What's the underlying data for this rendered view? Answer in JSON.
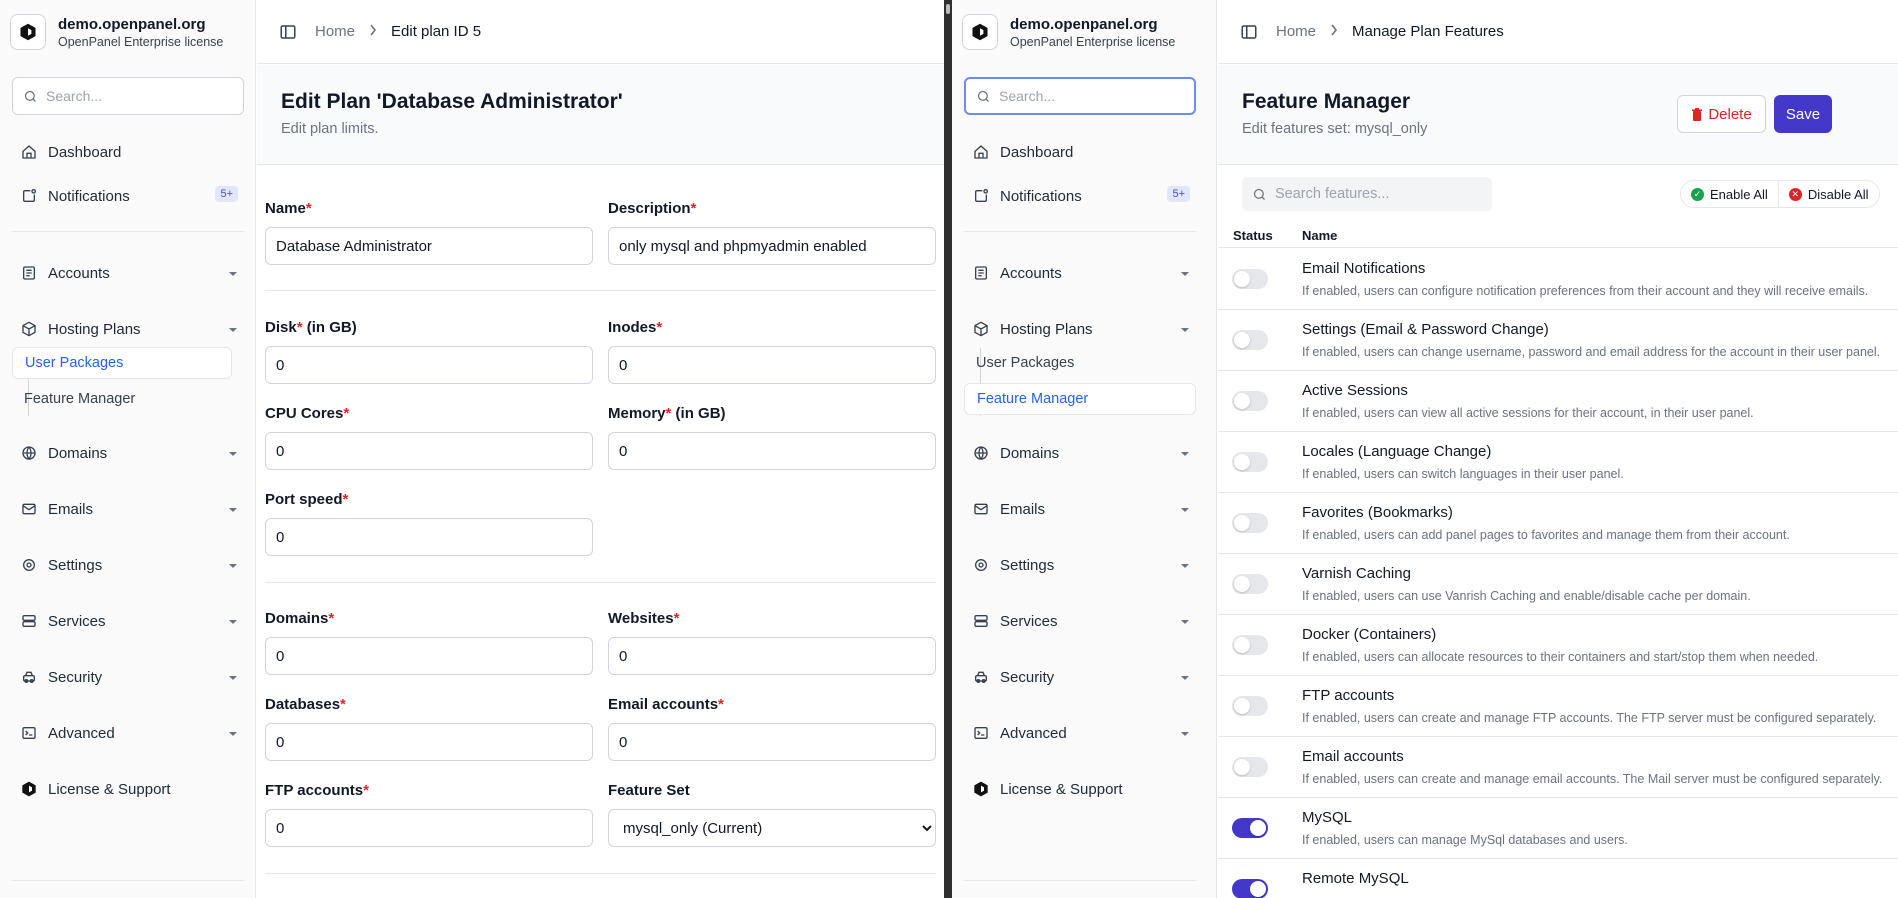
{
  "sidebar": {
    "brand_title": "demo.openpanel.org",
    "brand_subtitle": "OpenPanel Enterprise license",
    "search_placeholder": "Search...",
    "items": {
      "dashboard": "Dashboard",
      "notifications": "Notifications",
      "notifications_badge": "5+",
      "accounts": "Accounts",
      "hosting_plans": "Hosting Plans",
      "user_packages": "User Packages",
      "feature_manager": "Feature Manager",
      "domains": "Domains",
      "emails": "Emails",
      "settings": "Settings",
      "services": "Services",
      "security": "Security",
      "advanced": "Advanced",
      "license": "License & Support"
    }
  },
  "left": {
    "breadcrumb": {
      "home": "Home",
      "current": "Edit plan ID 5"
    },
    "title": "Edit Plan 'Database Administrator'",
    "subtitle": "Edit plan limits.",
    "required_mark": "*",
    "fields": {
      "name": {
        "label": "Name",
        "value": "Database Administrator"
      },
      "description": {
        "label": "Description",
        "value": "only mysql and phpmyadmin enabled"
      },
      "disk": {
        "label": "Disk",
        "suffix": " (in GB)",
        "value": "0"
      },
      "inodes": {
        "label": "Inodes",
        "value": "0"
      },
      "cpu": {
        "label": "CPU Cores",
        "value": "0"
      },
      "memory": {
        "label": "Memory",
        "suffix": " (in GB)",
        "value": "0"
      },
      "port_speed": {
        "label": "Port speed",
        "value": "0"
      },
      "domains": {
        "label": "Domains",
        "value": "0"
      },
      "websites": {
        "label": "Websites",
        "value": "0"
      },
      "databases": {
        "label": "Databases",
        "value": "0"
      },
      "email_accounts": {
        "label": "Email accounts",
        "value": "0"
      },
      "ftp_accounts": {
        "label": "FTP accounts",
        "value": "0"
      },
      "feature_set": {
        "label": "Feature Set",
        "value": "mysql_only (Current)"
      }
    }
  },
  "right": {
    "breadcrumb": {
      "home": "Home",
      "current": "Manage Plan Features"
    },
    "title": "Feature Manager",
    "subtitle": "Edit features set: mysql_only",
    "delete_label": "Delete",
    "save_label": "Save",
    "search_placeholder": "Search features...",
    "enable_all": "Enable All",
    "disable_all": "Disable All",
    "col_status": "Status",
    "col_name": "Name",
    "features": [
      {
        "name": "Email Notifications",
        "desc": "If enabled, users can configure notification preferences from their account and they will receive emails.",
        "enabled": false
      },
      {
        "name": "Settings (Email & Password Change)",
        "desc": "If enabled, users can change username, password and email address for the account in their user panel.",
        "enabled": false
      },
      {
        "name": "Active Sessions",
        "desc": "If enabled, users can view all active sessions for their account, in their user panel.",
        "enabled": false
      },
      {
        "name": "Locales (Language Change)",
        "desc": "If enabled, users can switch languages in their user panel.",
        "enabled": false
      },
      {
        "name": "Favorites (Bookmarks)",
        "desc": "If enabled, users can add panel pages to favorites and manage them from their account.",
        "enabled": false
      },
      {
        "name": "Varnish Caching",
        "desc": "If enabled, users can use Vanrish Caching and enable/disable cache per domain.",
        "enabled": false
      },
      {
        "name": "Docker (Containers)",
        "desc": "If enabled, users can allocate resources to their containers and start/stop them when needed.",
        "enabled": false
      },
      {
        "name": "FTP accounts",
        "desc": "If enabled, users can create and manage FTP accounts. The FTP server must be configured separately.",
        "enabled": false
      },
      {
        "name": "Email accounts",
        "desc": "If enabled, users can create and manage email accounts. The Mail server must be configured separately.",
        "enabled": false
      },
      {
        "name": "MySQL",
        "desc": "If enabled, users can manage MySql databases and users.",
        "enabled": true
      },
      {
        "name": "Remote MySQL",
        "desc": "",
        "enabled": true
      }
    ]
  }
}
